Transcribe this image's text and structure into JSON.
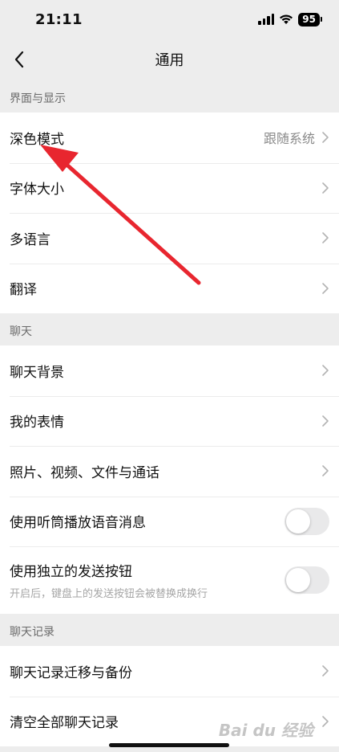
{
  "status": {
    "time": "21:11",
    "battery": "95"
  },
  "nav": {
    "title": "通用"
  },
  "sections": [
    {
      "header": "界面与显示",
      "rows": [
        {
          "label": "深色模式",
          "value": "跟随系统"
        },
        {
          "label": "字体大小"
        },
        {
          "label": "多语言"
        },
        {
          "label": "翻译"
        }
      ]
    },
    {
      "header": "聊天",
      "rows": [
        {
          "label": "聊天背景"
        },
        {
          "label": "我的表情"
        },
        {
          "label": "照片、视频、文件与通话"
        },
        {
          "label": "使用听筒播放语音消息",
          "toggle": false
        },
        {
          "label": "使用独立的发送按钮",
          "sub": "开启后，键盘上的发送按钮会被替换成换行",
          "toggle": false
        }
      ]
    },
    {
      "header": "聊天记录",
      "rows": [
        {
          "label": "聊天记录迁移与备份"
        },
        {
          "label": "清空全部聊天记录"
        }
      ]
    }
  ],
  "watermark": "Bai du 经验",
  "colors": {
    "annotation_arrow": "#e8262f",
    "toggle_off": "#e9e9ea"
  }
}
